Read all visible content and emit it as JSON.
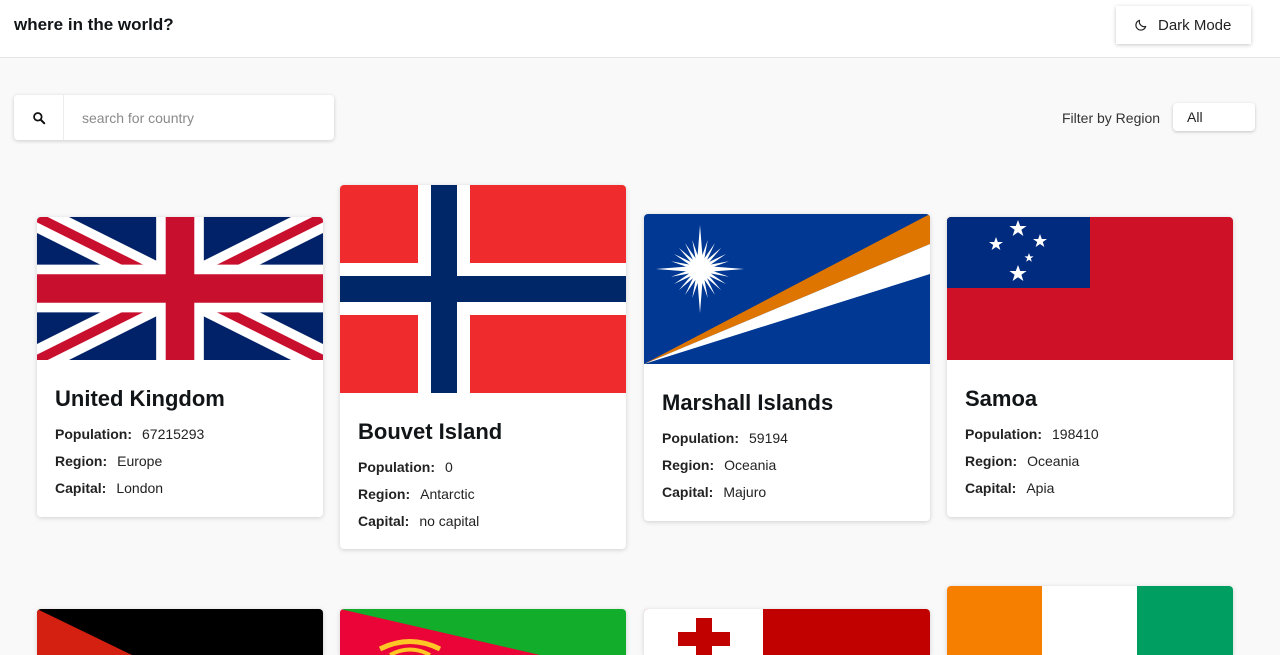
{
  "header": {
    "title": "where in the world?",
    "dark_mode_label": "Dark Mode",
    "dark_mode_icon": "moon-icon"
  },
  "search": {
    "placeholder": "search for country",
    "value": "",
    "icon": "search-icon"
  },
  "filter": {
    "label": "Filter by Region",
    "selected": "All"
  },
  "labels": {
    "population": "Population:",
    "region": "Region:",
    "capital": "Capital:"
  },
  "countries": [
    {
      "name": "United Kingdom",
      "population": "67215293",
      "region": "Europe",
      "capital": "London",
      "flag": "united-kingdom-flag"
    },
    {
      "name": "Bouvet Island",
      "population": "0",
      "region": "Antarctic",
      "capital": "no capital",
      "flag": "norway-flag"
    },
    {
      "name": "Marshall Islands",
      "population": "59194",
      "region": "Oceania",
      "capital": "Majuro",
      "flag": "marshall-islands-flag"
    },
    {
      "name": "Samoa",
      "population": "198410",
      "region": "Oceania",
      "capital": "Apia",
      "flag": "samoa-flag"
    }
  ],
  "next_row_flags": [
    "afghanistan-flag",
    "eritrea-flag",
    "tonga-flag",
    "ivory-coast-flag"
  ],
  "colors": {
    "background": "#f9f9f9",
    "card": "#ffffff",
    "text": "#111517"
  }
}
